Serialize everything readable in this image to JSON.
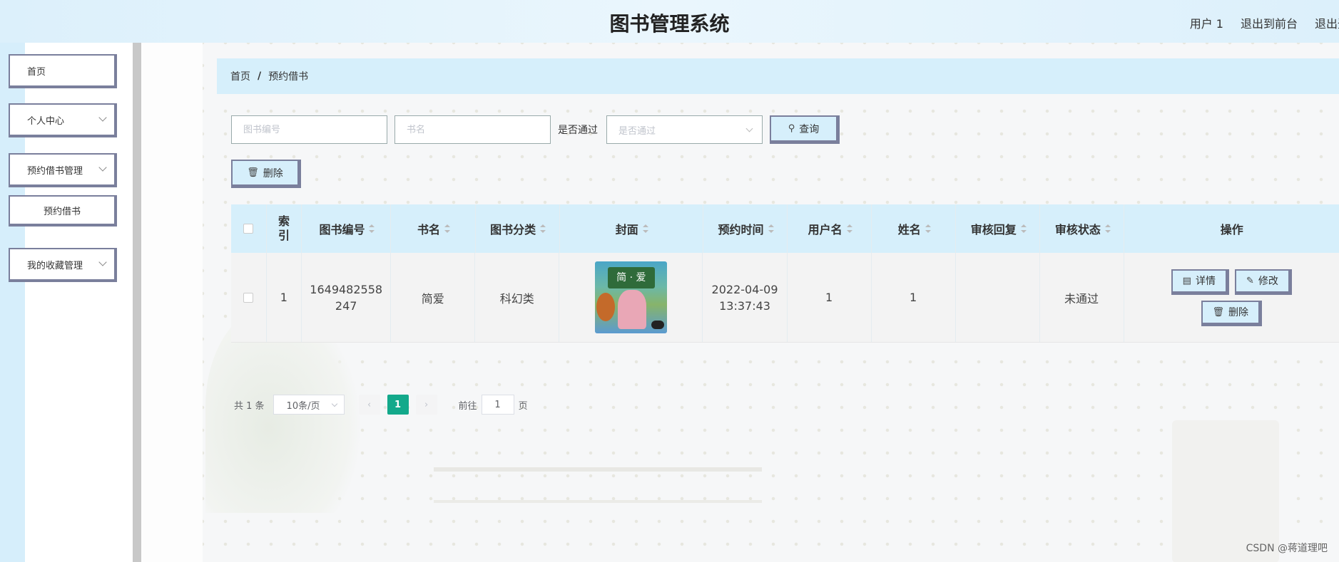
{
  "header": {
    "title": "图书管理系统",
    "user": "用户 1",
    "back_to_front": "退出到前台",
    "logout": "退出登录"
  },
  "sidebar": {
    "items": [
      {
        "label": "首页"
      },
      {
        "label": "个人中心"
      },
      {
        "label": "预约借书管理"
      },
      {
        "label": "预约借书"
      },
      {
        "label": "我的收藏管理"
      }
    ]
  },
  "breadcrumb": {
    "home": "首页",
    "sep": "/",
    "current": "预约借书"
  },
  "search": {
    "book_no_placeholder": "图书编号",
    "book_name_placeholder": "书名",
    "approved_label": "是否通过",
    "approved_placeholder": "是否通过",
    "query_label": "查询",
    "delete_label": "删除"
  },
  "table": {
    "headers": {
      "index": "索引",
      "book_no": "图书编号",
      "book_name": "书名",
      "category": "图书分类",
      "cover": "封面",
      "reserve_time": "预约时间",
      "username": "用户名",
      "name": "姓名",
      "review_reply": "审核回复",
      "review_status": "审核状态",
      "actions": "操作"
    },
    "rows": [
      {
        "index": "1",
        "book_no": "1649482558247",
        "book_name": "简爱",
        "category": "科幻类",
        "cover_text": "简 · 爱",
        "reserve_time": "2022-04-09 13:37:43",
        "username": "1",
        "name": "1",
        "review_reply": "",
        "review_status": "未通过",
        "detail_label": "详情",
        "edit_label": "修改",
        "delete_label": "删除"
      }
    ]
  },
  "pagination": {
    "total": "共 1 条",
    "page_size": "10条/页",
    "current_page": "1",
    "goto_label": "前往",
    "goto_value": "1",
    "page_unit": "页"
  },
  "watermark": "CSDN @蒋道理吧",
  "colors": {
    "accent": "#d6effb",
    "border": "#7a7f9c",
    "page_active": "#13a98b"
  }
}
